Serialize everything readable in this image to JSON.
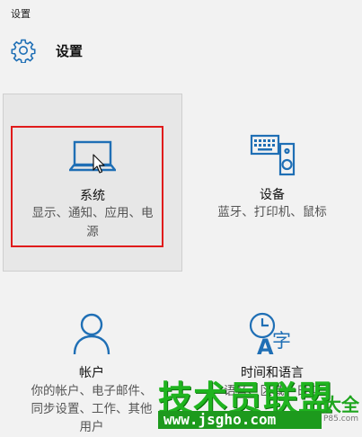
{
  "window": {
    "title": "设置"
  },
  "header": {
    "title": "设置",
    "icon": "gear-icon"
  },
  "tiles": [
    {
      "name": "系统",
      "desc_line1": "显示、通知、应用、电",
      "desc_line2": "源",
      "icon": "laptop-icon",
      "highlighted": true
    },
    {
      "name": "设备",
      "desc_line1": "蓝牙、打印机、鼠标",
      "icon": "keyboard-speaker-icon"
    },
    {
      "name": "帐户",
      "desc_line1": "你的帐户、电子邮件、",
      "desc_line2": "同步设置、工作、其他",
      "desc_line3": "用户",
      "icon": "person-icon"
    },
    {
      "name": "时间和语言",
      "desc_line1": "语音、区域、日期",
      "icon": "clock-language-icon"
    }
  ],
  "watermark": {
    "main": "技术员联盟",
    "daquan": "大全",
    "url": "www.jsgho.com",
    "small": "P85.com"
  },
  "colors": {
    "accent": "#1f6fb5",
    "highlight": "#e01b1b",
    "watermark": "#1fb41f"
  }
}
